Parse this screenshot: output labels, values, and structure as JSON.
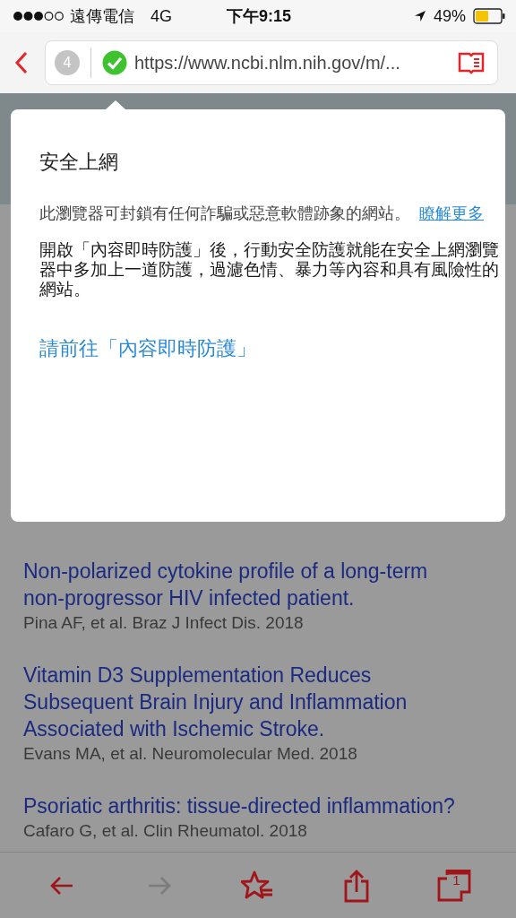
{
  "status_bar": {
    "carrier": "遠傳電信",
    "network": "4G",
    "time": "下午9:15",
    "battery": "49%"
  },
  "toolbar": {
    "tab_count": "4",
    "url": "https://www.ncbi.nlm.nih.gov/m/..."
  },
  "popup": {
    "title": "安全上網",
    "description": "此瀏覽器可封鎖有任何詐騙或惡意軟體跡象的網站。",
    "learn_more": "瞭解更多",
    "body": "開啟「內容即時防護」後，行動安全防護就能在安全上網瀏覽器中多加上一道防護，過濾色情、暴力等內容和具有風險性的網站。",
    "action": "請前往「內容即時防護」"
  },
  "articles": [
    {
      "title": "Non-polarized cytokine profile of a long-term non-progressor HIV infected patient.",
      "citation": "Pina AF, et al. Braz J Infect Dis. 2018"
    },
    {
      "title": "Vitamin D3 Supplementation Reduces Subsequent Brain Injury and Inflammation Associated with Ischemic Stroke.",
      "citation": "Evans MA, et al. Neuromolecular Med. 2018"
    },
    {
      "title": "Psoriatic arthritis: tissue-directed inflammation?",
      "citation": "Cafaro G, et al. Clin Rheumatol. 2018"
    }
  ],
  "bottom_bar": {
    "buttons": [
      {
        "kind": "back",
        "disabled": false
      },
      {
        "kind": "forward",
        "disabled": true
      },
      {
        "kind": "bookmarks",
        "disabled": false
      },
      {
        "kind": "share",
        "disabled": false
      },
      {
        "kind": "tabs",
        "disabled": false,
        "count": "1"
      }
    ]
  }
}
